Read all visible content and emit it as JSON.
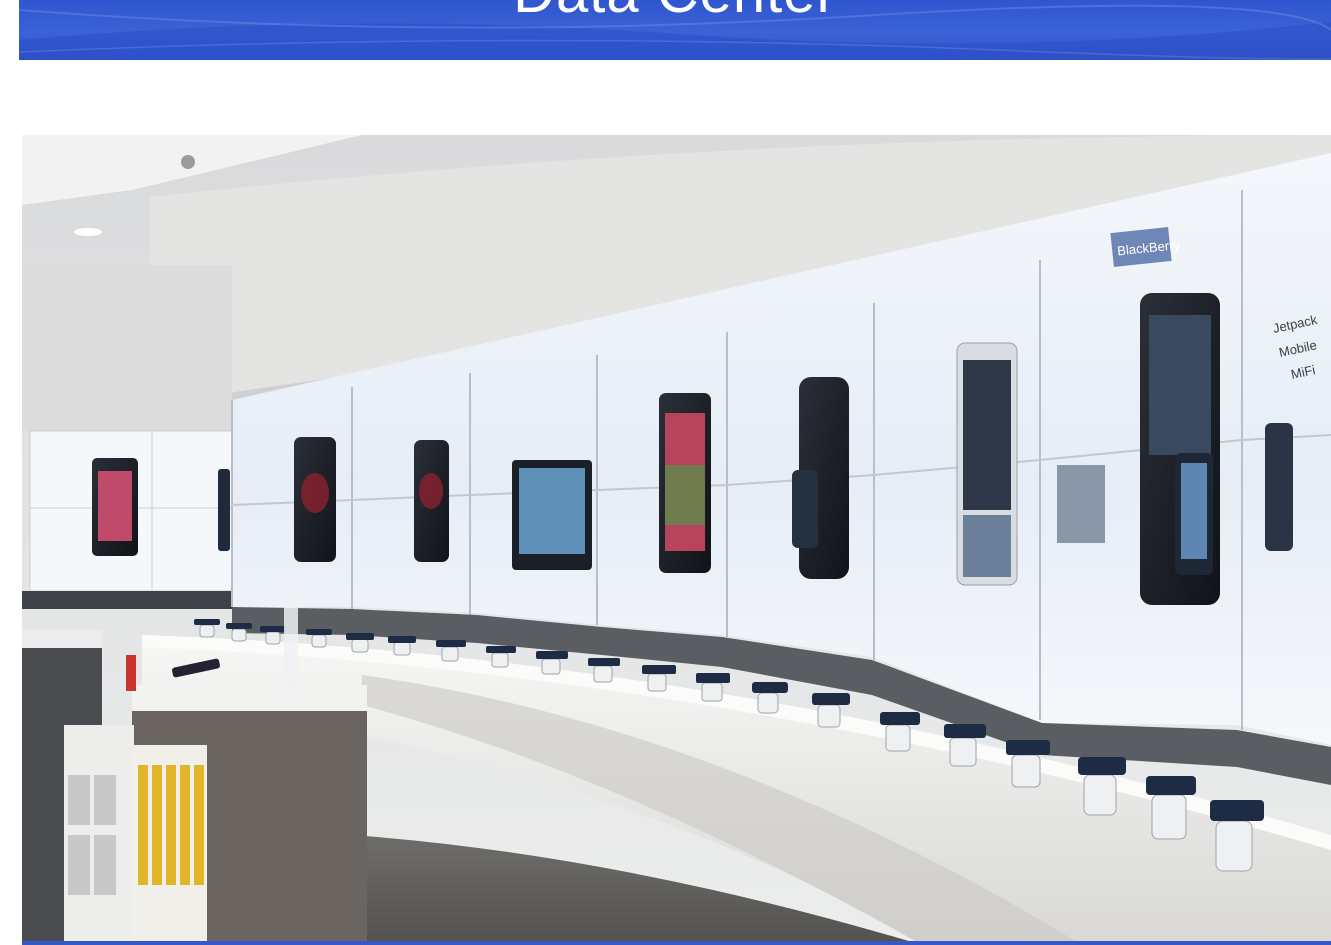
{
  "header": {
    "title": "Data Center",
    "background_color": "#3558d0",
    "text_color": "#ffffff"
  },
  "hero_image": {
    "phone_display_labels": [
      "Jetpack",
      "Mobile",
      "MiFi"
    ],
    "brand_label": "BlackBerry",
    "icon": "retail-display-photo"
  }
}
